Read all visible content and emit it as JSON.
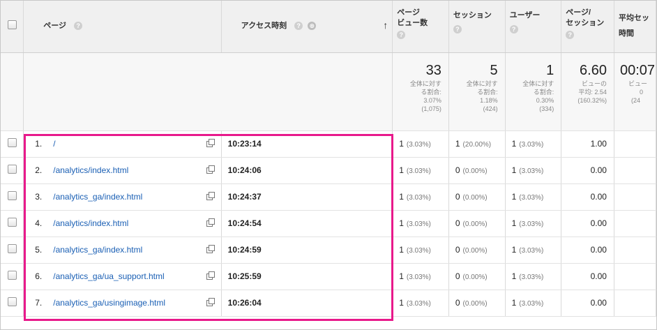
{
  "columns": {
    "page": "ページ",
    "access_time": "アクセス時刻",
    "pageviews": [
      "ページ",
      "ビュー数"
    ],
    "sessions": "セッション",
    "users": "ユーザー",
    "pages_per_session": [
      "ページ/",
      "セッション"
    ],
    "avg_session": [
      "平均セッ",
      "時間"
    ]
  },
  "icons": {
    "help": "?",
    "close": "⊗",
    "sort": "↑"
  },
  "summary": {
    "pageviews": {
      "value": "33",
      "sub": [
        "全体に対す",
        "る割合:",
        "3.07%",
        "(1,075)"
      ]
    },
    "sessions": {
      "value": "5",
      "sub": [
        "全体に対す",
        "る割合:",
        "1.18%",
        "(424)"
      ]
    },
    "users": {
      "value": "1",
      "sub": [
        "全体に対す",
        "る割合:",
        "0.30%",
        "(334)"
      ]
    },
    "pages_per_session": {
      "value": "6.60",
      "sub": [
        "ビューの",
        "平均: 2.54",
        "(160.32%)"
      ]
    },
    "avg_session": {
      "value": "00:07",
      "sub": [
        "ビュー",
        "0",
        "(24"
      ]
    }
  },
  "rows": [
    {
      "num": "1.",
      "page": "/",
      "time": "10:23:14",
      "pv": "1",
      "pv_pct": "(3.03%)",
      "ses": "1",
      "ses_pct": "(20.00%)",
      "usr": "1",
      "usr_pct": "(3.03%)",
      "pps": "1.00"
    },
    {
      "num": "2.",
      "page": "/analytics/index.html",
      "time": "10:24:06",
      "pv": "1",
      "pv_pct": "(3.03%)",
      "ses": "0",
      "ses_pct": "(0.00%)",
      "usr": "1",
      "usr_pct": "(3.03%)",
      "pps": "0.00"
    },
    {
      "num": "3.",
      "page": "/analytics_ga/index.html",
      "time": "10:24:37",
      "pv": "1",
      "pv_pct": "(3.03%)",
      "ses": "0",
      "ses_pct": "(0.00%)",
      "usr": "1",
      "usr_pct": "(3.03%)",
      "pps": "0.00"
    },
    {
      "num": "4.",
      "page": "/analytics/index.html",
      "time": "10:24:54",
      "pv": "1",
      "pv_pct": "(3.03%)",
      "ses": "0",
      "ses_pct": "(0.00%)",
      "usr": "1",
      "usr_pct": "(3.03%)",
      "pps": "0.00"
    },
    {
      "num": "5.",
      "page": "/analytics_ga/index.html",
      "time": "10:24:59",
      "pv": "1",
      "pv_pct": "(3.03%)",
      "ses": "0",
      "ses_pct": "(0.00%)",
      "usr": "1",
      "usr_pct": "(3.03%)",
      "pps": "0.00"
    },
    {
      "num": "6.",
      "page": "/analytics_ga/ua_support.html",
      "time": "10:25:59",
      "pv": "1",
      "pv_pct": "(3.03%)",
      "ses": "0",
      "ses_pct": "(0.00%)",
      "usr": "1",
      "usr_pct": "(3.03%)",
      "pps": "0.00"
    },
    {
      "num": "7.",
      "page": "/analytics_ga/usingimage.html",
      "time": "10:26:04",
      "pv": "1",
      "pv_pct": "(3.03%)",
      "ses": "0",
      "ses_pct": "(0.00%)",
      "usr": "1",
      "usr_pct": "(3.03%)",
      "pps": "0.00"
    }
  ],
  "highlight_color": "#e8198b"
}
